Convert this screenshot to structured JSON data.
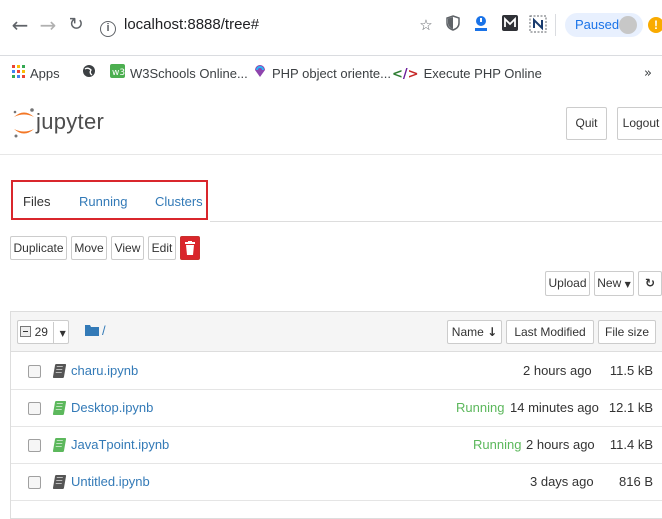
{
  "browser": {
    "url": "localhost:8888/tree#",
    "profile_status": "Paused",
    "update_badge": "!",
    "extensions": [
      "star-icon",
      "shield-extension-icon",
      "download-extension-icon",
      "m-extension-icon",
      "n-extension-icon"
    ],
    "bookmarks": [
      {
        "label": "Apps",
        "icon": "apps-grid-icon"
      },
      {
        "label": "",
        "icon": "globe-icon"
      },
      {
        "label": "W3Schools Online...",
        "icon": "w3schools-icon"
      },
      {
        "label": "PHP object oriente...",
        "icon": "php-icon"
      },
      {
        "label": "Execute PHP Online",
        "icon": "code-tag-icon"
      }
    ],
    "more": "»"
  },
  "header": {
    "logo_text": "jupyter",
    "quit_label": "Quit",
    "logout_label": "Logout"
  },
  "tabs": [
    {
      "label": "Files",
      "active": true
    },
    {
      "label": "Running",
      "active": false
    },
    {
      "label": "Clusters",
      "active": false
    }
  ],
  "toolbar": {
    "duplicate_label": "Duplicate",
    "move_label": "Move",
    "view_label": "View",
    "edit_label": "Edit",
    "delete_icon": "trash-icon",
    "upload_label": "Upload",
    "new_label": "New",
    "refresh_icon": "refresh-icon"
  },
  "listing_header": {
    "selected_count": "29",
    "breadcrumb": "/",
    "name_col": "Name",
    "modified_col": "Last Modified",
    "size_col": "File size"
  },
  "files": [
    {
      "name": "charu.ipynb",
      "status": "",
      "modified": "2 hours ago",
      "size": "11.5 kB",
      "icon_color": "#555555"
    },
    {
      "name": "Desktop.ipynb",
      "status": "Running",
      "modified": "14 minutes ago",
      "size": "12.1 kB",
      "icon_color": "#5cb85c"
    },
    {
      "name": "JavaTpoint.ipynb",
      "status": "Running",
      "modified": "2 hours ago",
      "size": "11.4 kB",
      "icon_color": "#5cb85c"
    },
    {
      "name": "Untitled.ipynb",
      "status": "",
      "modified": "3 days ago",
      "size": "816 B",
      "icon_color": "#555555"
    }
  ],
  "colors": {
    "link": "#337ab7",
    "running": "#5cb85c",
    "highlight_box": "#d9262c",
    "delete_button": "#d9262c",
    "jupyter_orange": "#f37726"
  }
}
